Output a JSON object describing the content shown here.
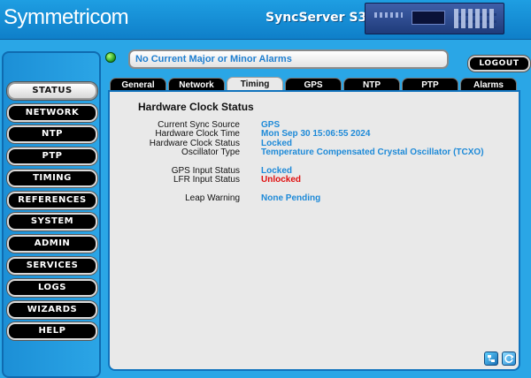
{
  "header": {
    "logo": "Symmetricom",
    "product": "SyncServer S300"
  },
  "sidebar": {
    "items": [
      {
        "label": "STATUS",
        "active": true
      },
      {
        "label": "NETWORK"
      },
      {
        "label": "NTP"
      },
      {
        "label": "PTP"
      },
      {
        "label": "TIMING"
      },
      {
        "label": "REFERENCES"
      },
      {
        "label": "SYSTEM"
      },
      {
        "label": "ADMIN"
      },
      {
        "label": "SERVICES"
      },
      {
        "label": "LOGS"
      },
      {
        "label": "WIZARDS"
      },
      {
        "label": "HELP"
      }
    ]
  },
  "alarm": {
    "message": "No Current Major or Minor Alarms",
    "led_color": "#2ea82e"
  },
  "logout_label": "LOGOUT",
  "tabs": [
    {
      "label": "General"
    },
    {
      "label": "Network"
    },
    {
      "label": "Timing",
      "active": true
    },
    {
      "label": "GPS"
    },
    {
      "label": "NTP"
    },
    {
      "label": "PTP"
    },
    {
      "label": "Alarms"
    }
  ],
  "panel": {
    "title": "Hardware Clock Status",
    "rows": [
      {
        "label": "Current Sync Source",
        "value": "GPS"
      },
      {
        "label": "Hardware Clock Time",
        "value": "Mon Sep 30 15:06:55 2024"
      },
      {
        "label": "Hardware Clock Status",
        "value": "Locked"
      },
      {
        "label": "Oscillator Type",
        "value": "Temperature Compensated Crystal Oscillator (TCXO)"
      },
      {
        "label": "GPS Input Status",
        "value": "Locked"
      },
      {
        "label": "LFR Input Status",
        "value": "Unlocked"
      },
      {
        "label": "Leap Warning",
        "value": "None Pending"
      }
    ]
  },
  "colors": {
    "value_blue": "#1e8ad8",
    "value_red": "#e01010",
    "background": "#2aa6e6"
  },
  "icons": [
    "tree-icon",
    "refresh-icon"
  ]
}
